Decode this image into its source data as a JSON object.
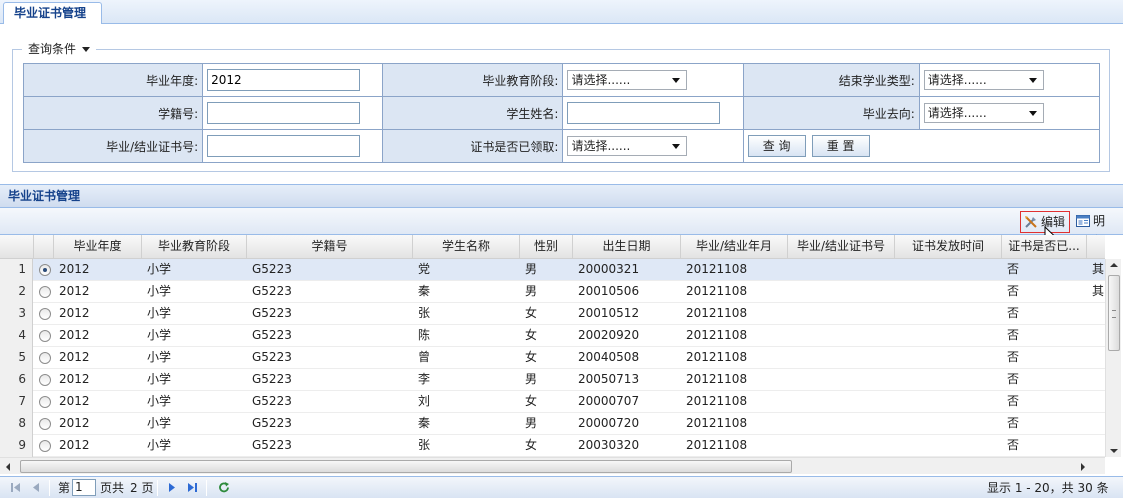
{
  "tab": {
    "title": "毕业证书管理"
  },
  "query": {
    "legend": "查询条件",
    "grad_year": {
      "label": "毕业年度:",
      "value": "2012"
    },
    "stage": {
      "label": "毕业教育阶段:",
      "value": "请选择......"
    },
    "end_type": {
      "label": "结束学业类型:",
      "value": "请选择......"
    },
    "student_no": {
      "label": "学籍号:",
      "value": ""
    },
    "student_name": {
      "label": "学生姓名:",
      "value": ""
    },
    "destination": {
      "label": "毕业去向:",
      "value": "请选择......"
    },
    "cert_no": {
      "label": "毕业/结业证书号:",
      "value": ""
    },
    "received": {
      "label": "证书是否已领取:",
      "value": "请选择......"
    },
    "search_button": "查 询",
    "reset_button": "重 置"
  },
  "grid": {
    "title": "毕业证书管理",
    "toolbar": {
      "edit": "编辑",
      "detail": "明细"
    },
    "columns": [
      "毕业年度",
      "毕业教育阶段",
      "学籍号",
      "学生名称",
      "性别",
      "出生日期",
      "毕业/结业年月",
      "毕业/结业证书号",
      "证书发放时间",
      "证书是否已..."
    ],
    "rows": [
      {
        "num": "1",
        "year": "2012",
        "stage": "小学",
        "no": "G5223",
        "name": "党",
        "sex": "男",
        "birth": "20000321",
        "grad": "20121108",
        "cert": "",
        "issue": "",
        "received": "否",
        "extra": "其"
      },
      {
        "num": "2",
        "year": "2012",
        "stage": "小学",
        "no": "G5223",
        "name": "秦",
        "sex": "男",
        "birth": "20010506",
        "grad": "20121108",
        "cert": "",
        "issue": "",
        "received": "否",
        "extra": "其"
      },
      {
        "num": "3",
        "year": "2012",
        "stage": "小学",
        "no": "G5223",
        "name": "张",
        "sex": "女",
        "birth": "20010512",
        "grad": "20121108",
        "cert": "",
        "issue": "",
        "received": "否",
        "extra": ""
      },
      {
        "num": "4",
        "year": "2012",
        "stage": "小学",
        "no": "G5223",
        "name": "陈",
        "sex": "女",
        "birth": "20020920",
        "grad": "20121108",
        "cert": "",
        "issue": "",
        "received": "否",
        "extra": ""
      },
      {
        "num": "5",
        "year": "2012",
        "stage": "小学",
        "no": "G5223",
        "name": "曾",
        "sex": "女",
        "birth": "20040508",
        "grad": "20121108",
        "cert": "",
        "issue": "",
        "received": "否",
        "extra": ""
      },
      {
        "num": "6",
        "year": "2012",
        "stage": "小学",
        "no": "G5223",
        "name": "李",
        "sex": "男",
        "birth": "20050713",
        "grad": "20121108",
        "cert": "",
        "issue": "",
        "received": "否",
        "extra": ""
      },
      {
        "num": "7",
        "year": "2012",
        "stage": "小学",
        "no": "G5223",
        "name": "刘",
        "sex": "女",
        "birth": "20000707",
        "grad": "20121108",
        "cert": "",
        "issue": "",
        "received": "否",
        "extra": ""
      },
      {
        "num": "8",
        "year": "2012",
        "stage": "小学",
        "no": "G5223",
        "name": "秦",
        "sex": "男",
        "birth": "20000720",
        "grad": "20121108",
        "cert": "",
        "issue": "",
        "received": "否",
        "extra": ""
      },
      {
        "num": "9",
        "year": "2012",
        "stage": "小学",
        "no": "G5223",
        "name": "张",
        "sex": "女",
        "birth": "20030320",
        "grad": "20121108",
        "cert": "",
        "issue": "",
        "received": "否",
        "extra": ""
      }
    ]
  },
  "pager": {
    "page_prefix": "第",
    "page_value": "1",
    "page_suffix": "页共",
    "total_pages": "2 页",
    "display": "显示 1 - 20，共 30 条"
  }
}
